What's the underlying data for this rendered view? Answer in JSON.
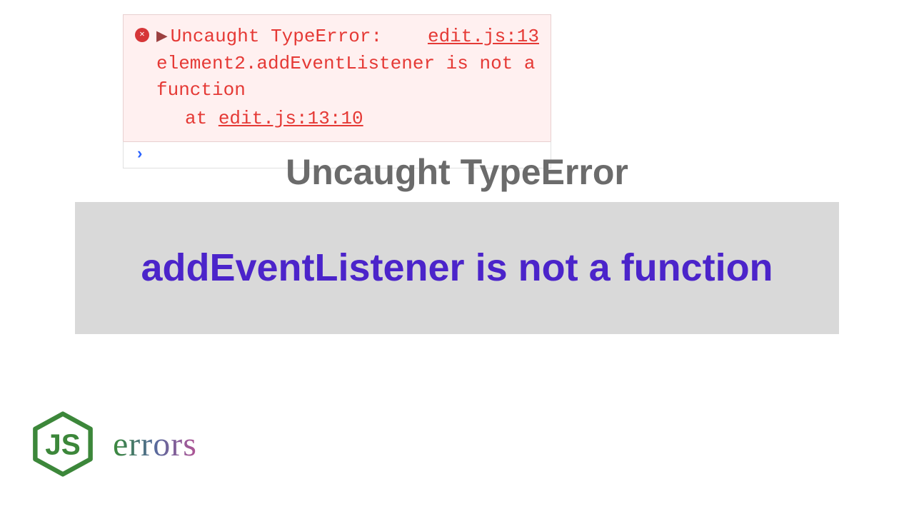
{
  "console": {
    "first_line_label": "Uncaught TypeError:",
    "source_link": "edit.js:13",
    "message_line2": "element2.addEventListener is not a",
    "message_line3": "function",
    "trace_prefix": "at ",
    "trace_link": "edit.js:13:10",
    "expand_symbol": "▶"
  },
  "prompt_symbol": "›",
  "subtitle": "Uncaught TypeError",
  "banner": "addEventListener is not a function",
  "logo": {
    "text": "JS",
    "label": "errors"
  }
}
